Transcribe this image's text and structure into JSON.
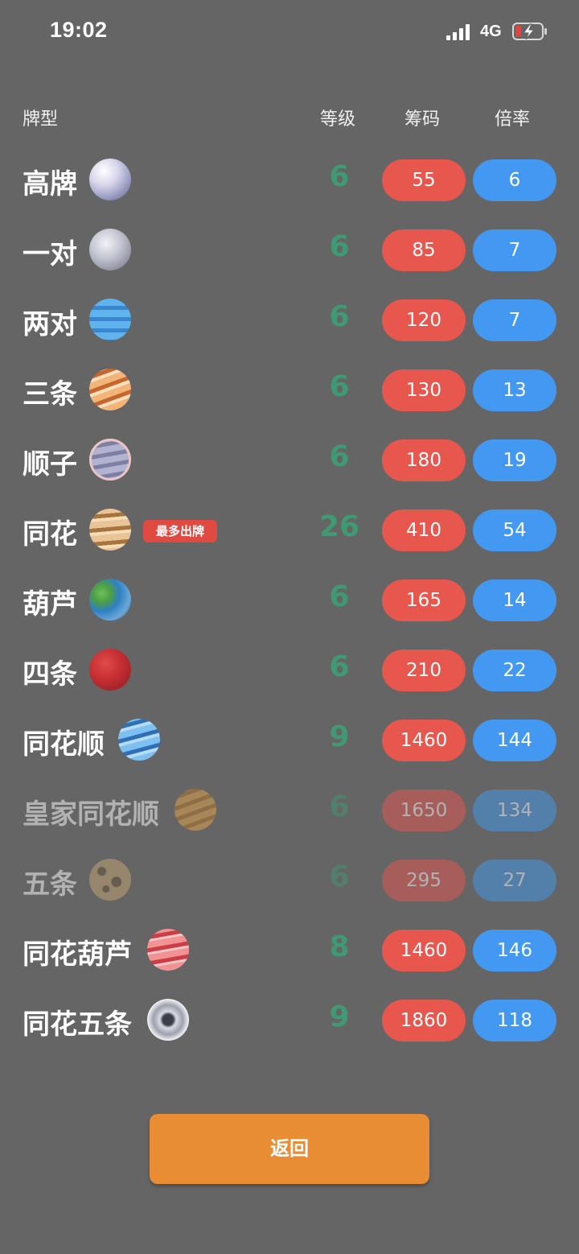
{
  "status_bar": {
    "time": "19:02",
    "network": "4G"
  },
  "header": {
    "type": "牌型",
    "level": "等级",
    "chips": "筹码",
    "multiplier": "倍率"
  },
  "rows": [
    {
      "name": "高牌",
      "level": "6",
      "chips": "55",
      "mult": "6",
      "planet_icon": "planet-pearl-icon"
    },
    {
      "name": "一对",
      "level": "6",
      "chips": "85",
      "mult": "7",
      "planet_icon": "planet-grey-icon"
    },
    {
      "name": "两对",
      "level": "6",
      "chips": "120",
      "mult": "7",
      "planet_icon": "planet-blue-ringed-icon"
    },
    {
      "name": "三条",
      "level": "6",
      "chips": "130",
      "mult": "13",
      "planet_icon": "planet-orange-striped-icon"
    },
    {
      "name": "顺子",
      "level": "6",
      "chips": "180",
      "mult": "19",
      "planet_icon": "planet-saturn-icon"
    },
    {
      "name": "同花",
      "level": "26",
      "chips": "410",
      "mult": "54",
      "planet_icon": "planet-jupiter-icon",
      "badge": "最多出牌"
    },
    {
      "name": "葫芦",
      "level": "6",
      "chips": "165",
      "mult": "14",
      "planet_icon": "planet-earth-icon"
    },
    {
      "name": "四条",
      "level": "6",
      "chips": "210",
      "mult": "22",
      "planet_icon": "planet-red-icon"
    },
    {
      "name": "同花顺",
      "level": "9",
      "chips": "1460",
      "mult": "144",
      "planet_icon": "planet-blue-striped-icon"
    },
    {
      "name": "皇家同花顺",
      "level": "6",
      "chips": "1650",
      "mult": "134",
      "planet_icon": "planet-gold-icon",
      "dimmed": true
    },
    {
      "name": "五条",
      "level": "6",
      "chips": "295",
      "mult": "27",
      "planet_icon": "planet-cratered-icon",
      "dimmed": true
    },
    {
      "name": "同花葫芦",
      "level": "8",
      "chips": "1460",
      "mult": "146",
      "planet_icon": "planet-pink-striped-icon"
    },
    {
      "name": "同花五条",
      "level": "9",
      "chips": "1860",
      "mult": "118",
      "planet_icon": "planet-silver-icon"
    }
  ],
  "back_button": {
    "label": "返回"
  },
  "colors": {
    "background": "#656565",
    "chips": "#e8574e",
    "multiplier": "#4399f1",
    "level": "#3f9a73",
    "back_button": "#e88d34",
    "badge": "#e04a41"
  }
}
